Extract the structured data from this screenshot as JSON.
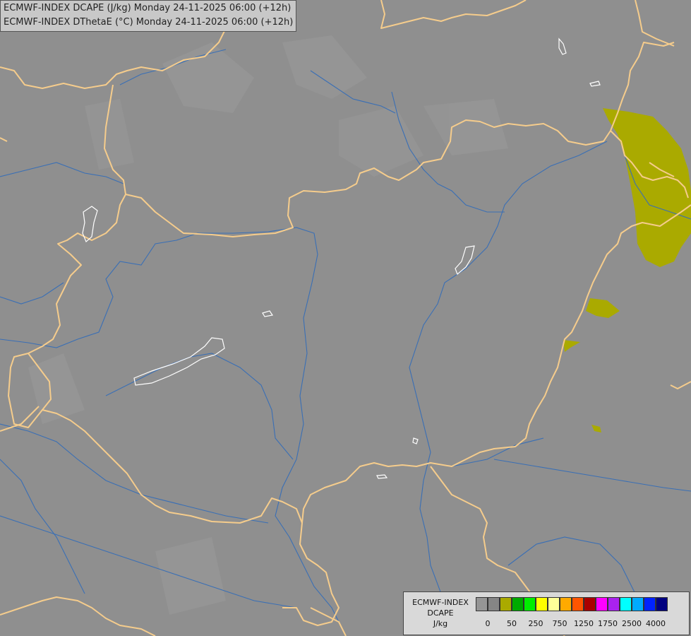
{
  "title": {
    "line1": "ECMWF-INDEX DCAPE (J/kg) Monday 24-11-2025 06:00 (+12h)",
    "line2": "ECMWF-INDEX DThetaE (°C) Monday 24-11-2025 06:00 (+12h)"
  },
  "legend": {
    "line1": "ECMWF-INDEX",
    "line2": "DCAPE",
    "line3": "J/kg",
    "colors": [
      "#959595",
      "#858585",
      "#aaaa00",
      "#00aa00",
      "#00ee00",
      "#ffff00",
      "#ffff99",
      "#ffaa00",
      "#ff5500",
      "#aa0000",
      "#ff00ff",
      "#aa22ee",
      "#00ffff",
      "#00aaff",
      "#0022ff",
      "#000080"
    ],
    "ticks": [
      "0",
      "50",
      "250",
      "750",
      "1250",
      "1750",
      "2500",
      "4000"
    ]
  },
  "colors": {
    "background": "#8f8f8f",
    "border": "#f5cc8c",
    "river": "#3a6fb5",
    "lake": "#ffffff",
    "dcape_50": "#aaaa00"
  }
}
